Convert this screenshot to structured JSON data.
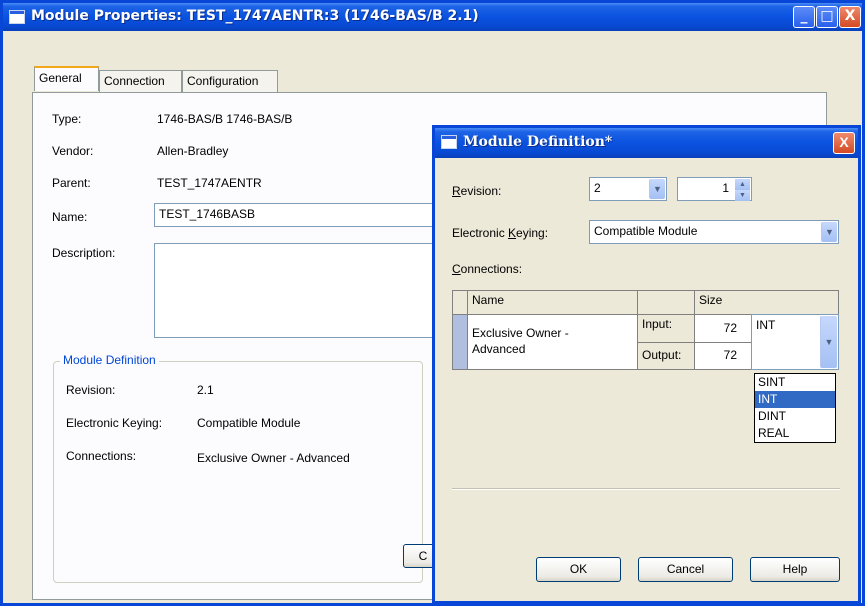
{
  "main_window": {
    "title": "Module Properties: TEST_1747AENTR:3 (1746-BAS/B 2.1)",
    "caption_buttons": {
      "minimize": "_",
      "maximize": "□",
      "close": "X"
    },
    "tabs": [
      "General",
      "Connection",
      "Configuration"
    ],
    "active_tab": "General",
    "fields": {
      "type_label": "Type:",
      "type_value": "1746-BAS/B 1746-BAS/B",
      "vendor_label": "Vendor:",
      "vendor_value": "Allen-Bradley",
      "parent_label": "Parent:",
      "parent_value": "TEST_1747AENTR",
      "name_label": "Name:",
      "name_value": "TEST_1746BASB",
      "description_label": "Description:",
      "description_value": ""
    },
    "module_definition_group": {
      "legend": "Module Definition",
      "revision_label": "Revision:",
      "revision_value": "2.1",
      "keying_label": "Electronic Keying:",
      "keying_value": "Compatible Module",
      "connections_label": "Connections:",
      "connections_value": "Exclusive Owner - Advanced"
    },
    "partial_button_label": "C"
  },
  "dialog": {
    "title": "Module Definition*",
    "close_label": "X",
    "revision": {
      "label_accel": "R",
      "label_rest": "evision:",
      "major": "2",
      "minor": "1"
    },
    "keying": {
      "label_pre": "Electronic ",
      "label_accel": "K",
      "label_rest": "eying:",
      "value": "Compatible Module"
    },
    "connections": {
      "label_accel": "C",
      "label_rest": "onnections:",
      "headers": {
        "name": "Name",
        "size": "Size"
      },
      "row": {
        "name_line1": "Exclusive Owner -",
        "name_line2": "Advanced",
        "input_label": "Input:",
        "input_size": "72",
        "output_label": "Output:",
        "output_size": "72",
        "data_type": "INT"
      },
      "data_type_options": [
        "SINT",
        "INT",
        "DINT",
        "REAL"
      ],
      "selected_option_index": 1
    },
    "buttons": {
      "ok": "OK",
      "cancel": "Cancel",
      "help": "Help"
    }
  }
}
